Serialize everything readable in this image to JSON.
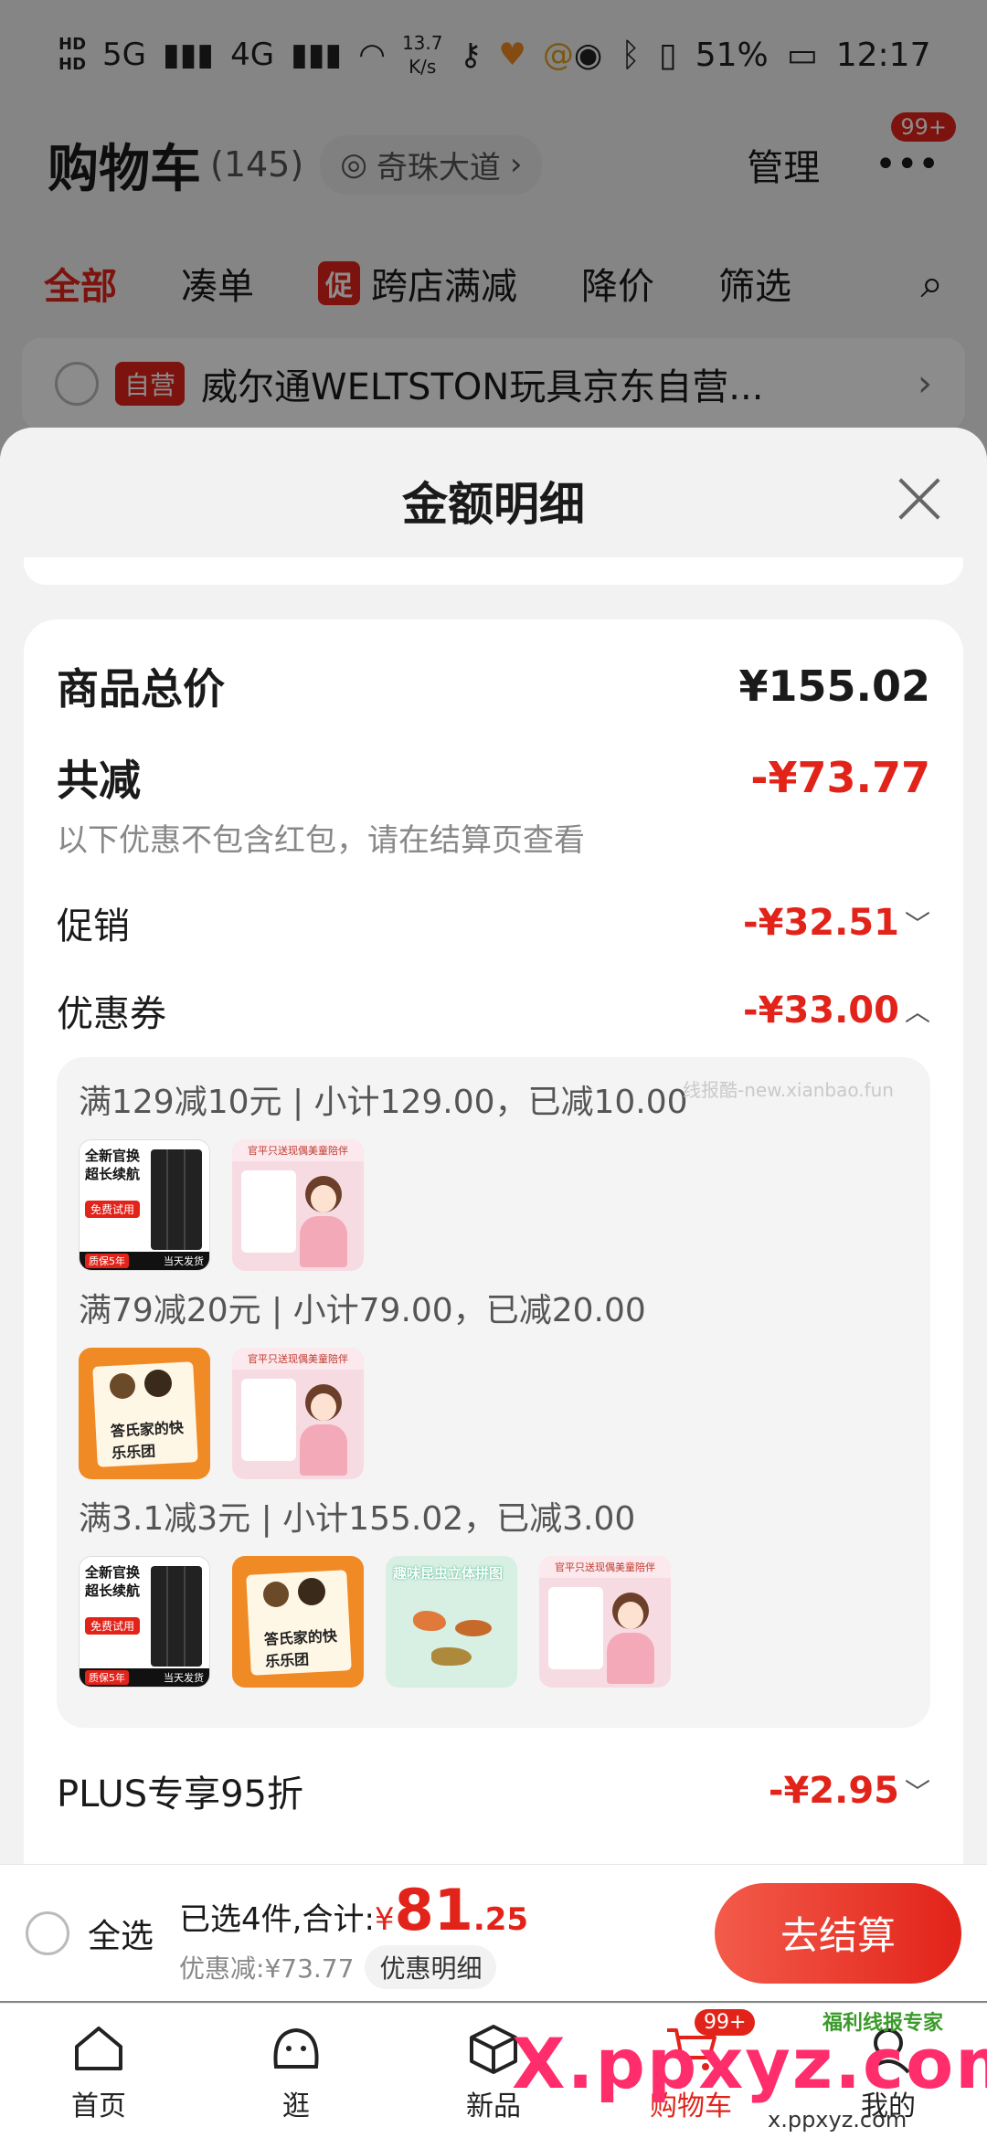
{
  "status_bar": {
    "time": "12:17",
    "battery": "51%",
    "net_speed_value": "13.7",
    "net_speed_unit": "K/s",
    "net_5g": "5G",
    "net_4g": "4G"
  },
  "header": {
    "title": "购物车",
    "count": "(145)",
    "treasure_label": "奇珠大道",
    "manage_label": "管理",
    "badge": "99+"
  },
  "tabs": {
    "all": "全部",
    "bundle": "凑单",
    "promo_chip": "促",
    "cross_shop": "跨店满减",
    "price_drop": "降价",
    "filter": "筛选"
  },
  "shop_row": {
    "badge": "自营",
    "name": "威尔通WELTSTON玩具京东自营..."
  },
  "sheet": {
    "title": "金额明细",
    "goods_total_label": "商品总价",
    "goods_total_value": "¥155.02",
    "total_discount_label": "共减",
    "total_discount_value": "-¥73.77",
    "note": "以下优惠不包含红包，请在结算页查看",
    "promo_label": "促销",
    "promo_value": "-¥32.51",
    "coupon_label": "优惠券",
    "coupon_value": "-¥33.00",
    "watermark": "线报酷-new.xianbao.fun",
    "coupon_lines": [
      "满129减10元 | 小计129.00，已减10.00",
      "满79减20元 | 小计79.00，已减20.00",
      "满3.1减3元 | 小计155.02，已减3.00"
    ],
    "thumb_text": {
      "battery_1": "全新官换",
      "battery_2": "超长续航",
      "battery_pill": "免费试用",
      "battery_foot_left": "质保5年",
      "battery_foot_right": "当天发货",
      "doll_top": "官平只送现偶美童陪伴",
      "book": "答氏家的快乐乐团",
      "puzzle": "趣味昆虫立体拼图"
    },
    "plus_label": "PLUS专享95折",
    "plus_value": "-¥2.95"
  },
  "checkout": {
    "select_all": "全选",
    "selected_prefix": "已选4件,合计:",
    "yen": "¥",
    "total_int": "81",
    "total_dec": ".25",
    "discount_text": "优惠减:¥73.77",
    "detail_button": "优惠明细",
    "checkout_button": "去结算"
  },
  "nav": {
    "home": "首页",
    "browse": "逛",
    "new": "新品",
    "cart": "购物车",
    "mine": "我的",
    "cart_badge": "99+"
  },
  "watermark_brand": {
    "main": "X.ppxyz.com",
    "sub": "x.ppxyz.com",
    "tag": "福利线报专家"
  },
  "colors": {
    "accent": "#e2231a",
    "brand_watermark": "#ff2d6b"
  }
}
